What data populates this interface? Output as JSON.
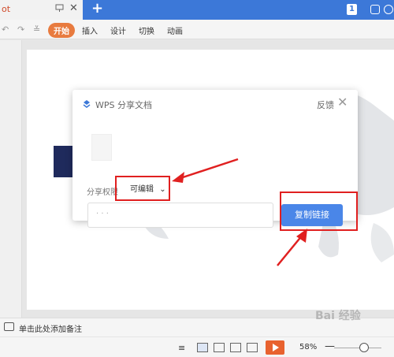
{
  "titlebar": {
    "doc_tab": "ot",
    "new_tab": "+",
    "badge": "1"
  },
  "ribbon": {
    "tabs": [
      "开始",
      "插入",
      "设计",
      "切换",
      "动画"
    ]
  },
  "dialog": {
    "title": "WPS 分享文档",
    "feedback": "反馈",
    "permission_label": "分享权限",
    "permission_value": "可编辑",
    "link_value": "·                  ·   ·",
    "copy_button": "复制链接"
  },
  "notes": {
    "placeholder": "单击此处添加备注"
  },
  "statusbar": {
    "zoom": "58%",
    "zoom_minus": "—"
  },
  "watermark": "Bai 经验",
  "colors": {
    "accent": "#3c78d8",
    "button": "#4a86e8",
    "ribbon_active": "#e87b3f",
    "highlight": "#e02020",
    "play": "#e8622f"
  }
}
